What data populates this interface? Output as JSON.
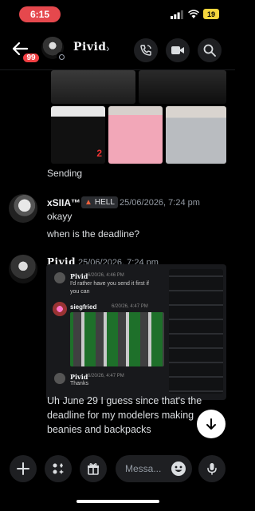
{
  "status": {
    "time": "6:15",
    "battery": "19"
  },
  "header": {
    "badge": "99",
    "title": "Pivid"
  },
  "thread": {
    "sending_text": "Sending",
    "image_label": "2",
    "messages": [
      {
        "author": "xSIIA™",
        "tag": "HELL",
        "time": "25/06/2026, 7:24 pm",
        "lines": [
          "okayy",
          "when is the deadline?"
        ]
      },
      {
        "author": "Pivid",
        "time": "25/06/2026, 7:24 pm",
        "embed": {
          "quote_author": "Pivid",
          "quote_time": "6/20/26, 4:46 PM",
          "quote_text": "I'd rather have you send it first if you can",
          "inner_author": "siegfried",
          "inner_time": "6/20/26, 4:47 PM",
          "footer_author": "Pivid",
          "footer_time": "6/20/26, 4:47 PM",
          "footer_text": "Thanks"
        },
        "text": "Uh June 29 I guess since that's the deadline for my modelers making beanies and backpacks"
      }
    ]
  },
  "composer": {
    "placeholder": "Messa..."
  },
  "colors": {
    "accent": "#5865f2",
    "badge": "#f23f43",
    "time_pill": "#e5484d",
    "battery": "#f5d63d"
  }
}
